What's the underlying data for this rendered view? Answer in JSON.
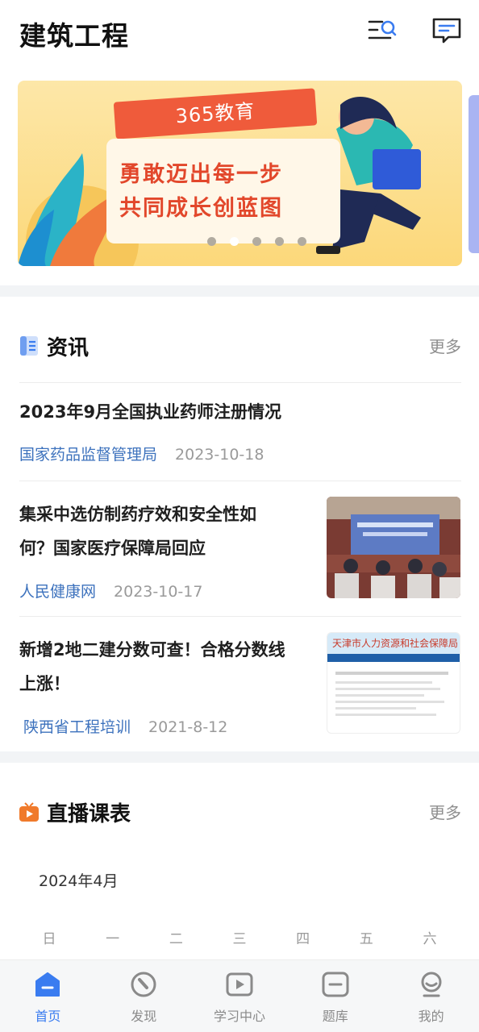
{
  "header": {
    "title": "建筑工程"
  },
  "banner": {
    "brand": "365教育",
    "line1": "勇敢迈出每一步",
    "line2": "共同成长创蓝图",
    "slide_count": 5,
    "active_slide": 1
  },
  "news_section": {
    "title": "资讯",
    "more_label": "更多",
    "items": [
      {
        "title": "2023年9月全国执业药师注册情况",
        "source": "国家药品监督管理局",
        "date": "2023-10-18"
      },
      {
        "title_line1": "集采中选仿制药疗效和安全性如",
        "title_line2": "何？国家医疗保障局回应",
        "source": "人民健康网",
        "date": "2023-10-17",
        "thumb_icon": "conference-photo"
      },
      {
        "title_line1": "新增2地二建分数可查！合格分数线",
        "title_line2": "上涨！",
        "source": "陕西省工程培训",
        "date": "2021-8-12",
        "thumb_icon": "webpage-screenshot",
        "thumb_heading": "天津市人力资源和社会保障局"
      }
    ]
  },
  "live_section": {
    "title": "直播课表",
    "more_label": "更多",
    "month": "2024年4月",
    "weekdays": [
      "日",
      "一",
      "二",
      "三",
      "四",
      "五",
      "六"
    ]
  },
  "tabbar": {
    "tabs": [
      {
        "label": "首页",
        "icon": "home-icon",
        "active": true
      },
      {
        "label": "发现",
        "icon": "compass-icon",
        "active": false
      },
      {
        "label": "学习中心",
        "icon": "play-icon",
        "active": false
      },
      {
        "label": "题库",
        "icon": "question-bank-icon",
        "active": false
      },
      {
        "label": "我的",
        "icon": "profile-icon",
        "active": false
      }
    ]
  },
  "colors": {
    "accent": "#3a7cf0",
    "source_link": "#3d72bd",
    "live_icon": "#f07a2b",
    "banner_bg": "#fcd87a"
  }
}
